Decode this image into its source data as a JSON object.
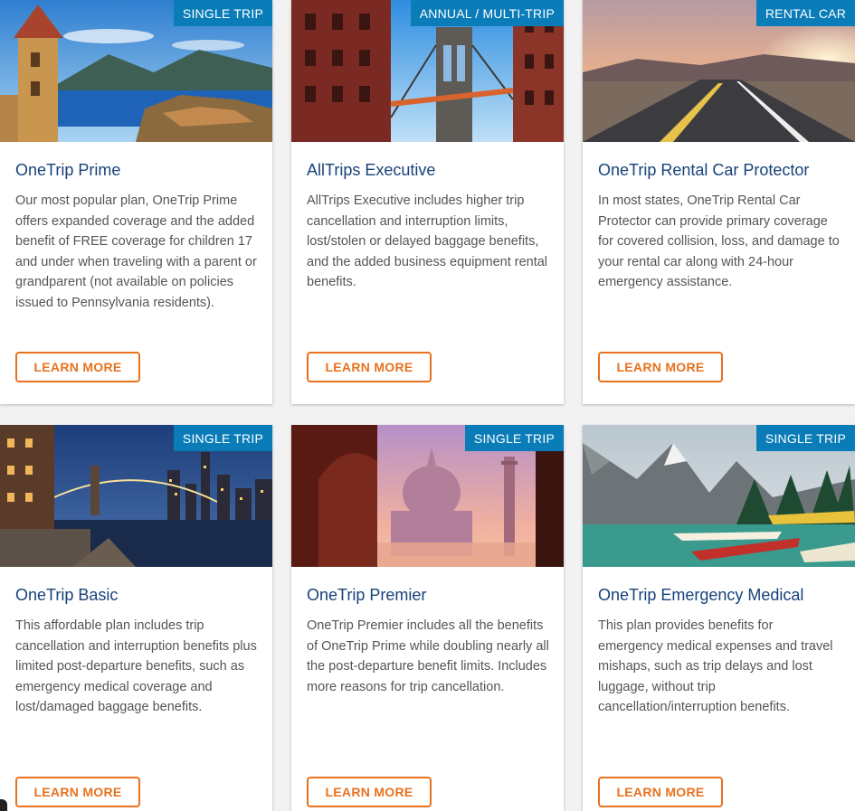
{
  "cards": [
    {
      "badge": "SINGLE TRIP",
      "title": "OneTrip Prime",
      "description": "Our most popular plan, OneTrip Prime offers expanded coverage and the added benefit of FREE coverage for children 17 and under when traveling with a parent or grandparent (not available on policies issued to Pennsylvania residents).",
      "button": "LEARN MORE"
    },
    {
      "badge": "ANNUAL / MULTI-TRIP",
      "title": "AllTrips Executive",
      "description": "AllTrips Executive includes higher trip cancellation and interruption limits, lost/stolen or delayed baggage benefits, and the added business equipment rental benefits.",
      "button": "LEARN MORE"
    },
    {
      "badge": "RENTAL CAR",
      "title": "OneTrip Rental Car Protector",
      "description": "In most states, OneTrip Rental Car Protector can provide primary coverage for covered collision, loss, and damage to your rental car along with 24-hour emergency assistance.",
      "button": "LEARN MORE"
    },
    {
      "badge": "SINGLE TRIP",
      "title": "OneTrip Basic",
      "description": "This affordable plan includes trip cancellation and interruption benefits plus limited post-departure benefits, such as emergency medical coverage and lost/damaged baggage benefits.",
      "button": "LEARN MORE"
    },
    {
      "badge": "SINGLE TRIP",
      "title": "OneTrip Premier",
      "description": "OneTrip Premier includes all the benefits of OneTrip Prime while doubling nearly all the post-departure benefit limits. Includes more reasons for trip cancellation.",
      "button": "LEARN MORE"
    },
    {
      "badge": "SINGLE TRIP",
      "title": "OneTrip Emergency Medical",
      "description": "This plan provides benefits for emergency medical expenses and travel mishaps, such as trip delays and lost luggage, without trip cancellation/interruption benefits.",
      "button": "LEARN MORE"
    }
  ],
  "colors": {
    "badge": "#0a7cb8",
    "title": "#17427a",
    "button": "#e8711e"
  }
}
